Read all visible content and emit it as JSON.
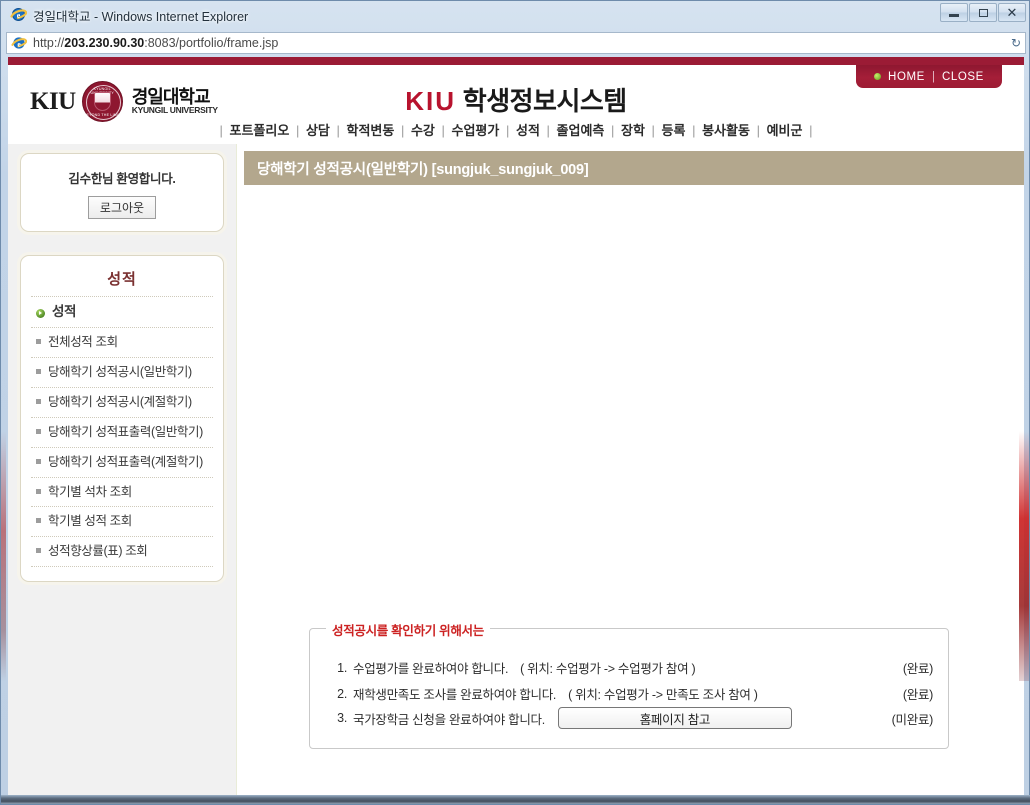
{
  "window": {
    "title": "경일대학교 - Windows Internet Explorer",
    "minimize_label": "최소화",
    "maximize_label": "최대화",
    "close_label": "닫기"
  },
  "address_bar": {
    "url_protocol": "http://",
    "url_host": "203.230.90.30",
    "url_rest": ":8083/portfolio/frame.jsp",
    "full_url": "http://203.230.90.30:8083/portfolio/frame.jsp"
  },
  "header": {
    "logo": {
      "kiu": "KIU",
      "seal_top": "KYUNGIL UNIVERSITY",
      "seal_bottom": "BEYOND THE LIMIT",
      "seal_center": "KIU",
      "name_kr": "경일대학교",
      "name_en": "KYUNGIL UNIVERSITY"
    },
    "site_title_brand": "KIU",
    "site_title_rest": " 학생정보시스템",
    "home_label": "HOME",
    "separator": "|",
    "close_label": "CLOSE"
  },
  "nav": {
    "items": [
      "포트폴리오",
      "상담",
      "학적변동",
      "수강",
      "수업평가",
      "성적",
      "졸업예측",
      "장학",
      "등록",
      "봉사활동",
      "예비군"
    ],
    "separator": "|"
  },
  "sidebar": {
    "welcome_text": "김수한님 환영합니다.",
    "logout_label": "로그아웃",
    "menu_heading": "성적",
    "menu_items": [
      {
        "label": "성적",
        "active": true
      },
      {
        "label": "전체성적 조회",
        "active": false
      },
      {
        "label": "당해학기 성적공시(일반학기)",
        "active": false
      },
      {
        "label": "당해학기 성적공시(계절학기)",
        "active": false
      },
      {
        "label": "당해학기 성적표출력(일반학기)",
        "active": false
      },
      {
        "label": "당해학기 성적표출력(계절학기)",
        "active": false
      },
      {
        "label": "학기별 석차 조회",
        "active": false
      },
      {
        "label": "학기별 성적 조회",
        "active": false
      },
      {
        "label": "성적향상률(표) 조회",
        "active": false
      }
    ]
  },
  "content": {
    "page_title": "당해학기 성적공시(일반학기) [sungjuk_sungjuk_009]",
    "notice": {
      "legend": "성적공시를 확인하기 위해서는",
      "rows": [
        {
          "num": "1.",
          "text": "수업평가를 완료하여야 합니다.",
          "where": "( 위치: 수업평가 -> 수업평가 참여 )",
          "status": "(완료)"
        },
        {
          "num": "2.",
          "text": "재학생만족도 조사를 완료하여야 합니다.",
          "where": "( 위치: 수업평가 -> 만족도 조사 참여 )",
          "status": "(완료)"
        },
        {
          "num": "3.",
          "text": "국가장학금 신청을 완료하여야 합니다.",
          "button_label": "홈페이지 참고",
          "status": "(미완료)"
        }
      ]
    }
  },
  "colors": {
    "crimson_band": "#9b1b35",
    "brand_red": "#b8132e",
    "title_bar_tan": "#b3a78d",
    "notice_red": "#cc2222",
    "menu_heading": "#7a3030"
  }
}
